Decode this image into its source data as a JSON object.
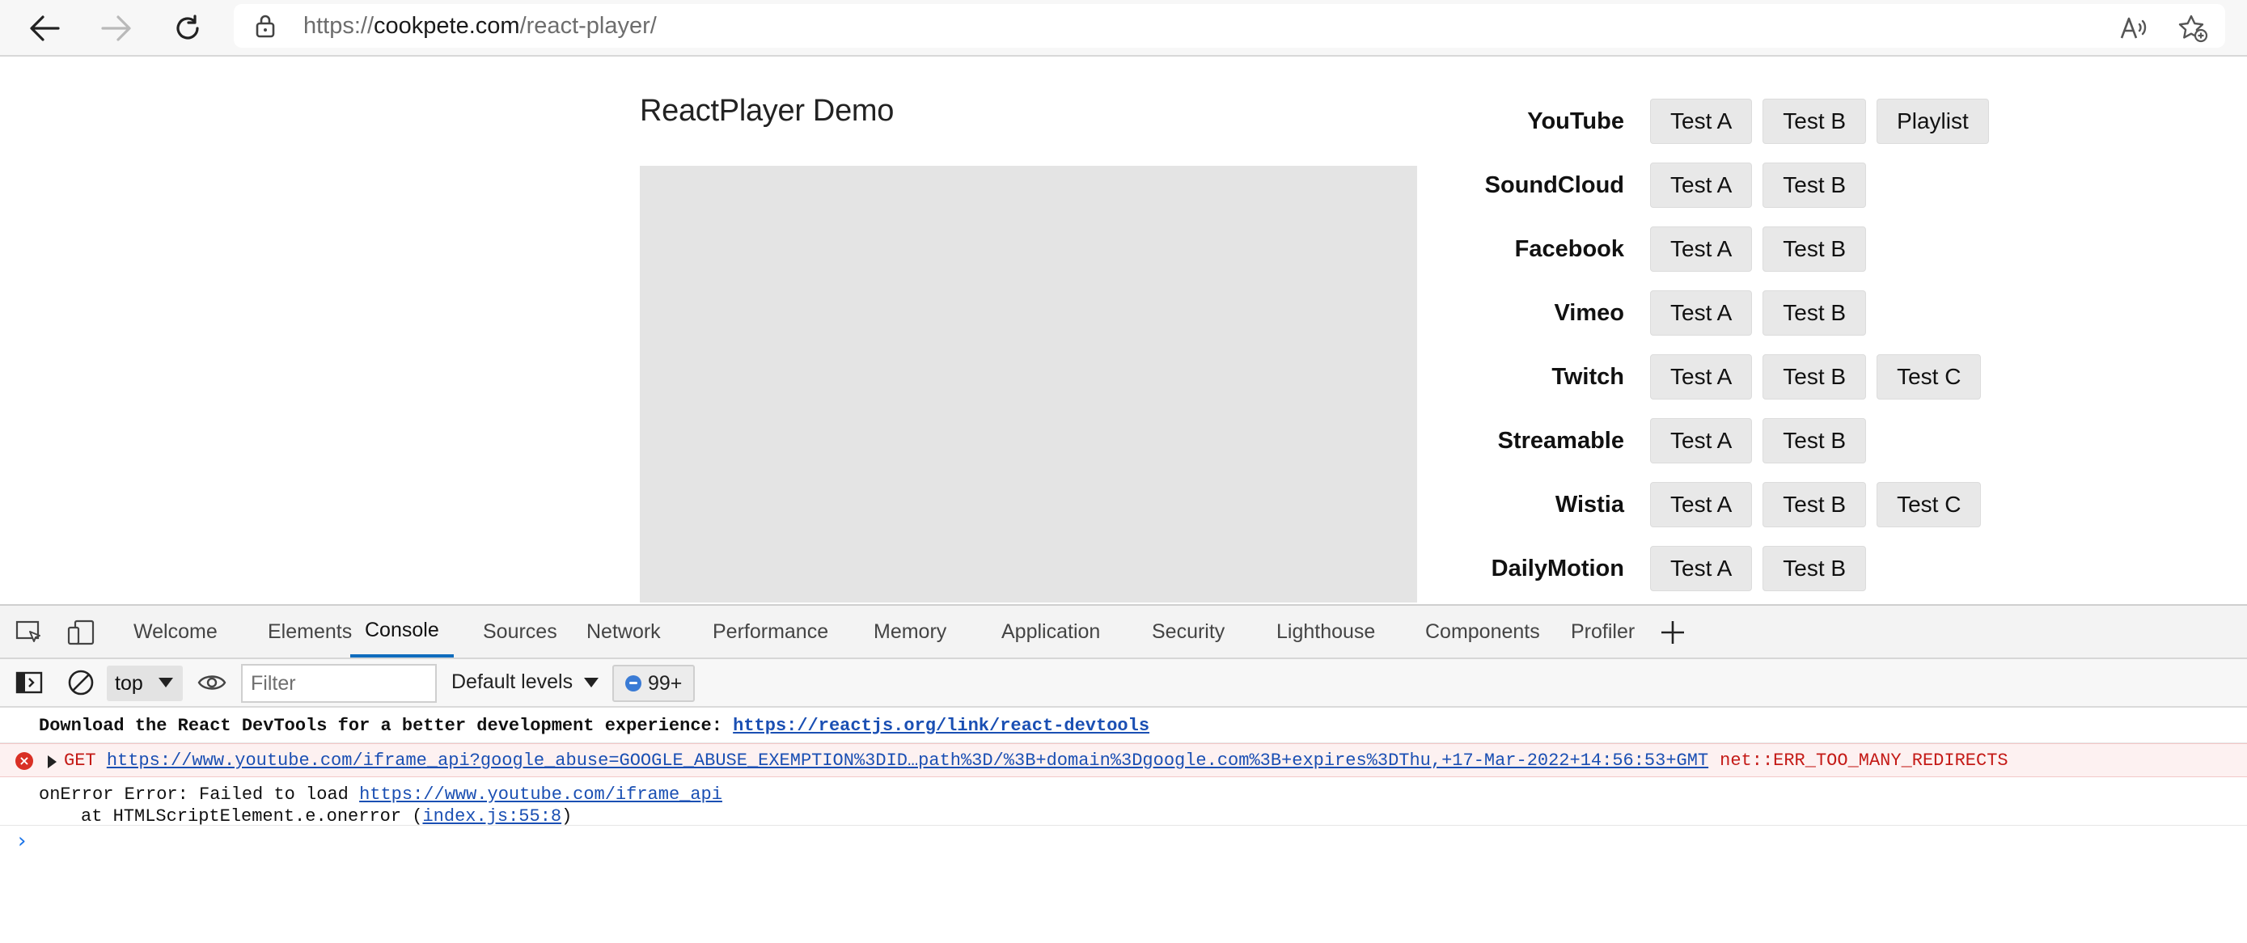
{
  "browser": {
    "url_prefix": "https://",
    "url_host": "cookpete.com",
    "url_path": "/react-player/"
  },
  "page": {
    "title": "ReactPlayer Demo",
    "providers": [
      {
        "label": "YouTube",
        "buttons": [
          "Test A",
          "Test B",
          "Playlist"
        ]
      },
      {
        "label": "SoundCloud",
        "buttons": [
          "Test A",
          "Test B"
        ]
      },
      {
        "label": "Facebook",
        "buttons": [
          "Test A",
          "Test B"
        ]
      },
      {
        "label": "Vimeo",
        "buttons": [
          "Test A",
          "Test B"
        ]
      },
      {
        "label": "Twitch",
        "buttons": [
          "Test A",
          "Test B",
          "Test C"
        ]
      },
      {
        "label": "Streamable",
        "buttons": [
          "Test A",
          "Test B"
        ]
      },
      {
        "label": "Wistia",
        "buttons": [
          "Test A",
          "Test B",
          "Test C"
        ]
      },
      {
        "label": "DailyMotion",
        "buttons": [
          "Test A",
          "Test B"
        ]
      }
    ]
  },
  "devtools": {
    "tabs": [
      "Welcome",
      "Elements",
      "Console",
      "Sources",
      "Network",
      "Performance",
      "Memory",
      "Application",
      "Security",
      "Lighthouse",
      "Components",
      "Profiler"
    ],
    "active_tab": "Console",
    "toolbar": {
      "context": "top",
      "filter_placeholder": "Filter",
      "levels": "Default levels",
      "issues_count": "99+"
    },
    "console": {
      "info_text": "Download the React DevTools for a better development experience: ",
      "info_link": "https://reactjs.org/link/react-devtools",
      "error_method": "GET ",
      "error_link": "https://www.youtube.com/iframe_api?google_abuse=GOOGLE_ABUSE_EXEMPTION%3DID…path%3D/%3B+domain%3Dgoogle.com%3B+expires%3DThu,+17-Mar-2022+14:56:53+GMT",
      "error_suffix": "net::ERR_TOO_MANY_REDIRECTS",
      "onerror_text": "onError Error: Failed to load ",
      "onerror_link": "https://www.youtube.com/iframe_api",
      "stack_text": "at HTMLScriptElement.e.onerror (",
      "stack_link": "index.js:55:8",
      "stack_close": ")",
      "prompt": "›"
    }
  },
  "colors": {
    "accent": "#0f6cbd",
    "error": "#c41a16",
    "link": "#1a4fb3"
  }
}
